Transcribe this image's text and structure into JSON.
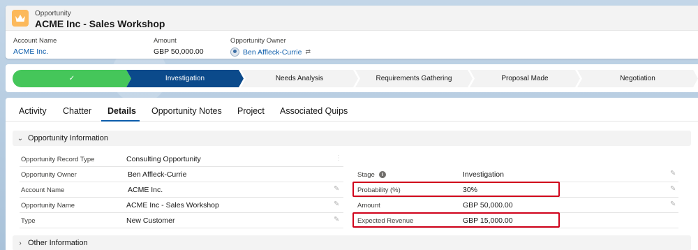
{
  "header": {
    "object_label": "Opportunity",
    "title": "ACME Inc - Sales Workshop",
    "fields": [
      {
        "label": "Account Name",
        "value": "ACME Inc."
      },
      {
        "label": "Amount",
        "value": "GBP 50,000.00"
      },
      {
        "label": "Opportunity Owner",
        "value": "Ben Affleck-Currie"
      }
    ]
  },
  "path": {
    "steps": [
      {
        "label": "✓",
        "status": "complete"
      },
      {
        "label": "Investigation",
        "status": "current"
      },
      {
        "label": "Needs Analysis",
        "status": "incomplete"
      },
      {
        "label": "Requirements Gathering",
        "status": "incomplete"
      },
      {
        "label": "Proposal Made",
        "status": "incomplete"
      },
      {
        "label": "Negotiation",
        "status": "incomplete"
      }
    ]
  },
  "tabs": [
    "Activity",
    "Chatter",
    "Details",
    "Opportunity Notes",
    "Project",
    "Associated Quips"
  ],
  "active_tab": "Details",
  "sections": {
    "opportunity_information": "Opportunity Information",
    "other_information": "Other Information"
  },
  "left_fields": [
    {
      "label": "Opportunity Record Type",
      "value": "Consulting Opportunity"
    },
    {
      "label": "Opportunity Owner",
      "value": "Ben Affleck-Currie"
    },
    {
      "label": "Account Name",
      "value": "ACME Inc."
    },
    {
      "label": "Opportunity Name",
      "value": "ACME Inc - Sales Workshop"
    },
    {
      "label": "Type",
      "value": "New Customer"
    }
  ],
  "right_fields": [
    {
      "label": "Stage",
      "value": "Investigation"
    },
    {
      "label": "Probability (%)",
      "value": "30%"
    },
    {
      "label": "Amount",
      "value": "GBP 50,000.00"
    },
    {
      "label": "Expected Revenue",
      "value": "GBP 15,000.00"
    }
  ],
  "colors": {
    "path_complete": "#45c65a",
    "path_current": "#0b4a8b",
    "link": "#0b5cab",
    "highlight_box": "#d0021b",
    "object_icon": "#fcb95b"
  },
  "icons": {
    "object": "crown-icon",
    "edit": "pencil-icon",
    "info": "info-icon",
    "owner_change": "change-owner-icon"
  }
}
